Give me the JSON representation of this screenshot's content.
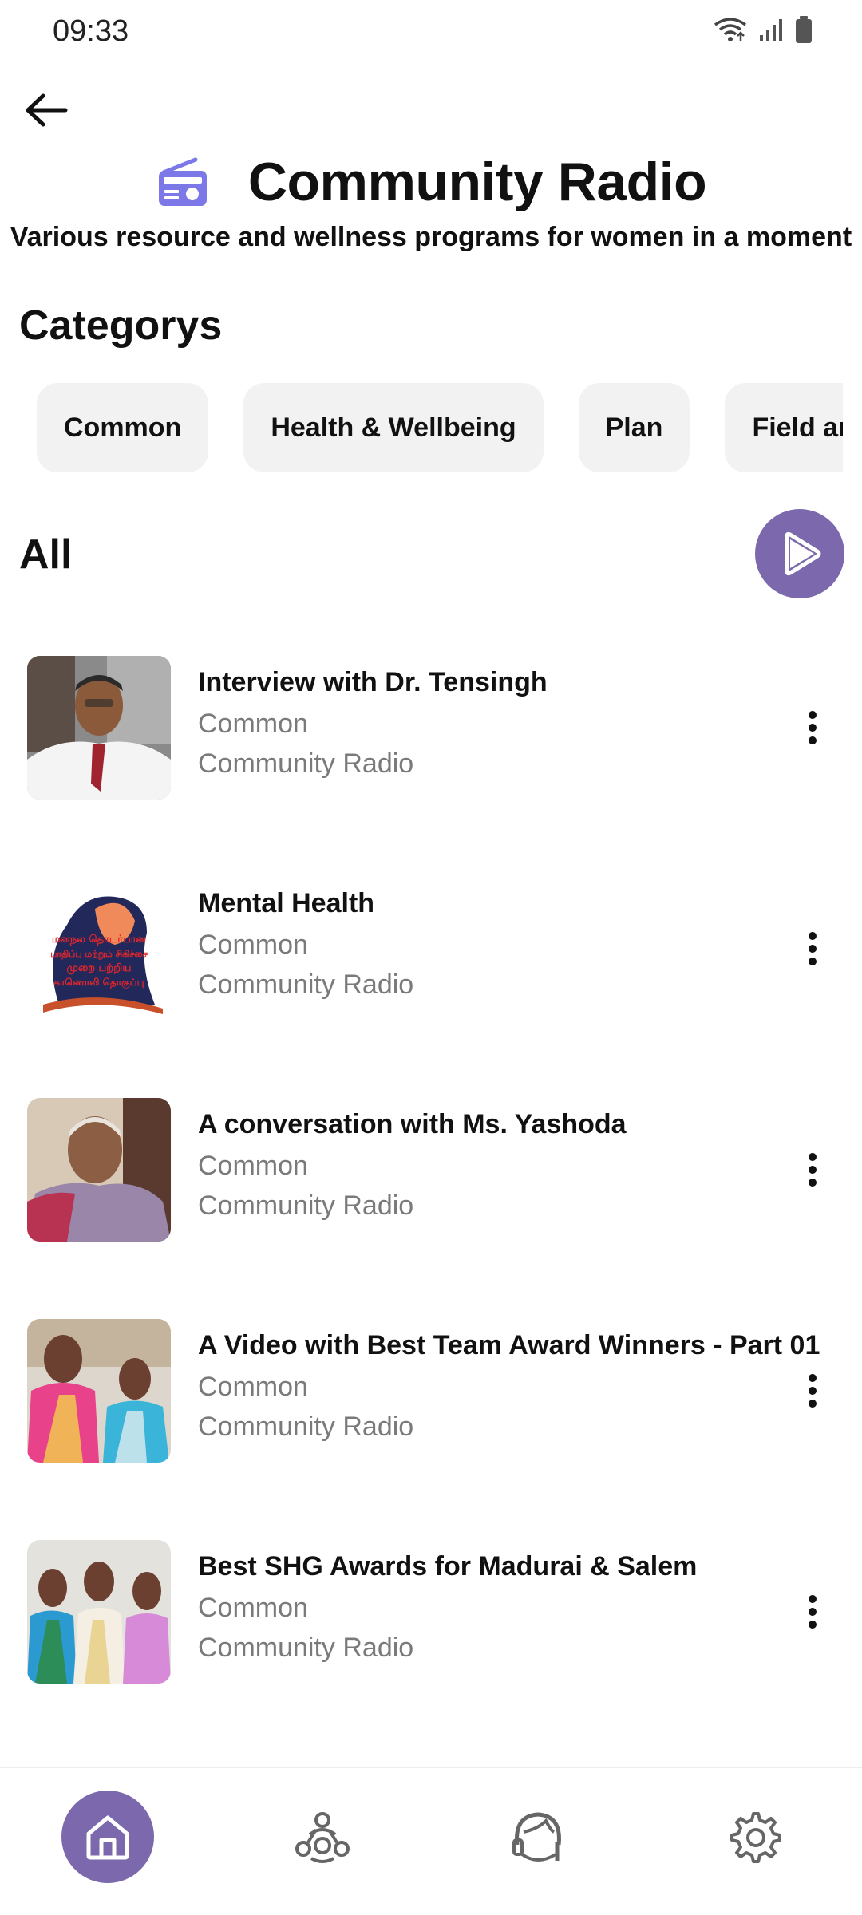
{
  "status_bar": {
    "time": "09:33"
  },
  "header": {
    "title": "Community Radio",
    "subtitle": "Various resource and wellness programs for women in a moment"
  },
  "categories": {
    "title": "Categorys",
    "chips": [
      "Common",
      "Health & Wellbeing",
      "Plan",
      "Field and"
    ]
  },
  "all_section": {
    "title": "All"
  },
  "programs": [
    {
      "title": "Interview with Dr. Tensingh",
      "category": "Common",
      "source": "Community Radio"
    },
    {
      "title": "Mental Health",
      "category": "Common",
      "source": "Community Radio"
    },
    {
      "title": "A conversation with Ms. Yashoda",
      "category": "Common",
      "source": "Community Radio"
    },
    {
      "title": "A Video with Best Team Award Winners - Part 01",
      "category": "Common",
      "source": "Community Radio"
    },
    {
      "title": "Best SHG Awards for Madurai & Salem",
      "category": "Common",
      "source": "Community Radio"
    }
  ],
  "thumbnail_text": {
    "mental_health": [
      "மனநல தொடர்பான",
      "பாதிப்பு மற்றும் சிகிச்சை",
      "முறை பற்றிய",
      "காணொலி தொகுப்பு"
    ]
  },
  "colors": {
    "accent": "#7b68ad",
    "radio_icon": "#7c78e8",
    "chip_background": "#f2f2f2",
    "meta_text": "#7a7a7a"
  },
  "icons": {
    "back": "arrow-left-icon",
    "header": "radio-icon",
    "play": "play-icon",
    "more": "more-vertical-icon",
    "nav": [
      "home-icon",
      "community-icon",
      "support-icon",
      "settings-icon"
    ]
  }
}
